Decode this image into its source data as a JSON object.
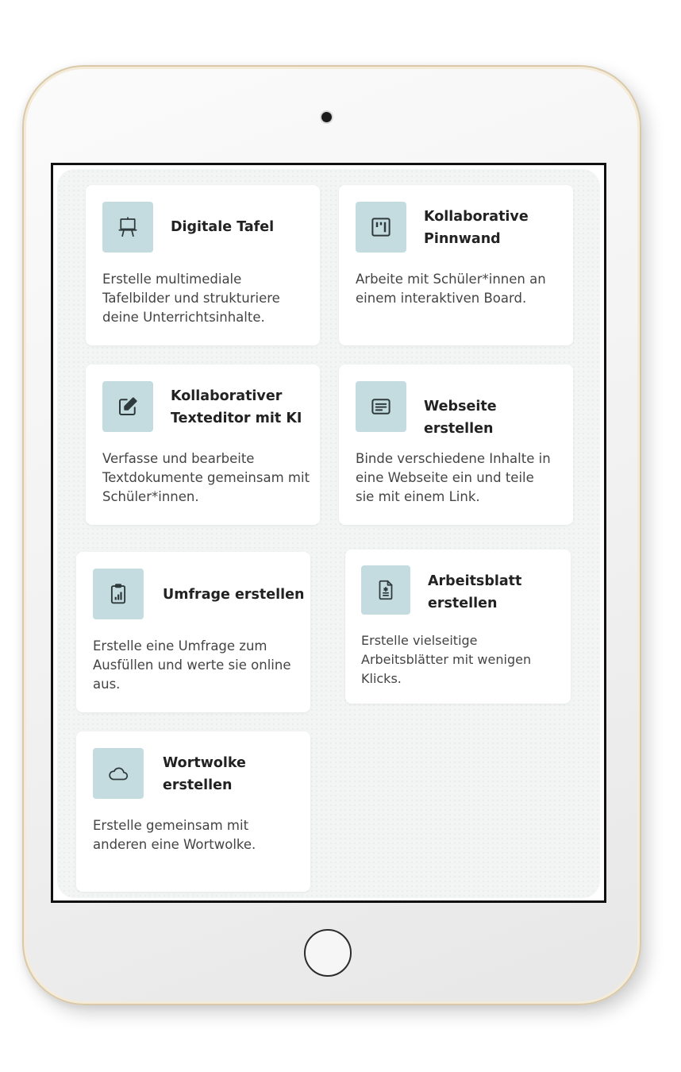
{
  "cards": [
    {
      "icon": "easel-icon",
      "title": "Digitale Tafel",
      "description": "Erstelle multimediale Tafelbilder und strukturiere deine Unterrichtsinhalte."
    },
    {
      "icon": "pinboard-icon",
      "title": "Kollaborative Pinnwand",
      "description": "Arbeite mit Schüler*innen an einem interaktiven Board."
    },
    {
      "icon": "edit-icon",
      "title": "Kollaborativer Texteditor mit KI",
      "description": "Verfasse und bearbeite Textdokumente gemeinsam mit Schüler*innen."
    },
    {
      "icon": "webpage-icon",
      "title": "Webseite erstellen",
      "description": "Binde verschiedene Inhalte in eine Webseite ein und teile sie mit einem Link."
    },
    {
      "icon": "survey-icon",
      "title": "Umfrage erstellen",
      "description": "Erstelle eine Umfrage zum Ausfüllen und werte sie online aus."
    },
    {
      "icon": "worksheet-icon",
      "title": "Arbeitsblatt erstellen",
      "description": "Erstelle vielseitige Arbeitsblätter mit wenigen Klicks."
    },
    {
      "icon": "cloud-icon",
      "title": "Wortwolke erstellen",
      "description": "Erstelle gemeinsam mit anderen eine Wortwolke."
    }
  ],
  "colors": {
    "icon_bg": "#c4dcdf",
    "icon_stroke": "#2f3a3c"
  }
}
